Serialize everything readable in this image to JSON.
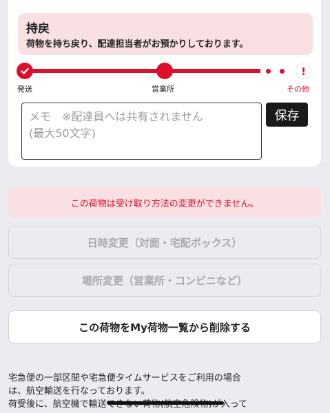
{
  "status": {
    "title": "持戻",
    "description": "荷物を持ち戻り、配達担当者がお預かりしております。"
  },
  "progress": {
    "steps": [
      {
        "label": "発送",
        "state": "done",
        "icon": "check-icon"
      },
      {
        "label": "営業所",
        "state": "current"
      },
      {
        "label": "その他",
        "state": "alert",
        "icon": "exclamation-icon"
      }
    ],
    "accent_color": "#dd0f2a"
  },
  "memo": {
    "placeholder": "メモ　※配達員へは共有されません\n(最大50文字)",
    "value": ""
  },
  "save_label": "保存",
  "notice": "この荷物は受け取り方法の変更ができません。",
  "buttons": {
    "datetime_change": "日時変更（対面・宅配ボックス）",
    "place_change": "場所変更（営業所・コンビニなど）",
    "delete": "この荷物をMy荷物一覧から削除する"
  },
  "footer": {
    "line1": "宅急便の一部区間や宅急便タイムサービスをご利用の場合",
    "line2": "は、航空輸送を行なっております。",
    "line3": "荷受後に、航空機で輸送できない荷物(航空危険物)が入って"
  }
}
